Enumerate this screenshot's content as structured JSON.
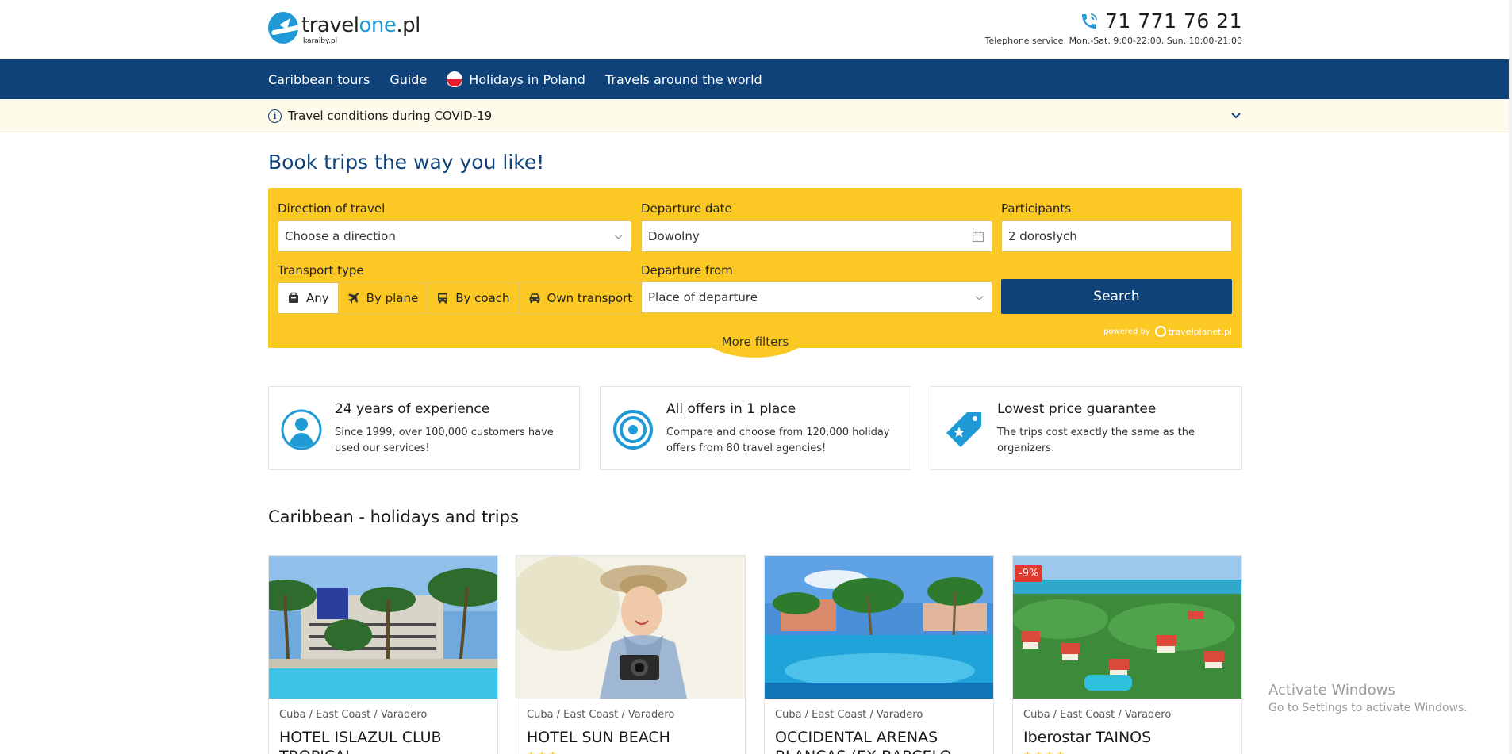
{
  "header": {
    "logo_main_a": "travel",
    "logo_main_b": "one",
    "logo_main_c": ".pl",
    "logo_sub": "karaiby.pl",
    "phone": "71 771 76 21",
    "hours": "Telephone service: Mon.-Sat. 9:00-22:00, Sun. 10:00-21:00"
  },
  "nav": {
    "items": [
      "Caribbean tours",
      "Guide",
      "Holidays in Poland",
      "Travels around the world"
    ]
  },
  "covid": {
    "label": "Travel conditions during COVID-19"
  },
  "title": "Book trips the way you like!",
  "search": {
    "direction_label": "Direction of travel",
    "direction_value": "Choose a direction",
    "date_label": "Departure date",
    "date_value": "Dowolny",
    "participants_label": "Participants",
    "participants_value": "2 dorosłych",
    "transport_label": "Transport type",
    "transport_options": [
      "Any",
      "By plane",
      "By coach",
      "Own transport"
    ],
    "departure_label": "Departure from",
    "departure_value": "Place of departure",
    "search_button": "Search",
    "powered_by": "powered by",
    "powered_brand": "travelplanet.pl",
    "more_filters": "More filters"
  },
  "features": [
    {
      "title": "24 years of experience",
      "desc": "Since 1999, over 100,000 customers have used our services!",
      "icon": "user-icon"
    },
    {
      "title": "All offers in 1 place",
      "desc": "Compare and choose from 120,000 holiday offers from 80 travel agencies!",
      "icon": "target-icon"
    },
    {
      "title": "Lowest price guarantee",
      "desc": "The trips cost exactly the same as the organizers.",
      "icon": "price-tag-icon"
    }
  ],
  "section_title": "Caribbean - holidays and trips",
  "cards": [
    {
      "location": "Cuba / East Coast / Varadero",
      "name": "HOTEL ISLAZUL CLUB TROPICAL",
      "stars": "★★★"
    },
    {
      "location": "Cuba / East Coast / Varadero",
      "name": "HOTEL SUN BEACH",
      "stars": "★★★"
    },
    {
      "location": "Cuba / East Coast / Varadero",
      "name": "OCCIDENTAL ARENAS BLANCAS (EX BARCELO",
      "stars": ""
    },
    {
      "location": "Cuba / East Coast / Varadero",
      "name": "Iberostar TAINOS",
      "stars": "★★★★",
      "badge": "-9%"
    }
  ],
  "watermark": {
    "line1": "Activate Windows",
    "line2": "Go to Settings to activate Windows."
  },
  "colors": {
    "navy": "#0e4279",
    "brand_blue": "#1f9ad6",
    "yellow": "#fcc823",
    "badge_red": "#e2382c"
  }
}
